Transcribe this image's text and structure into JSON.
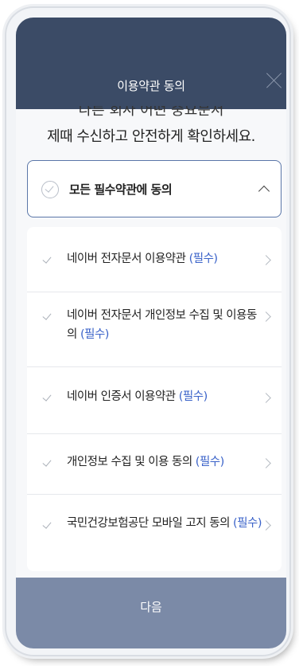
{
  "header": {
    "title": "이용약관 동의"
  },
  "intro": {
    "line1": "다른 회사 어떤 중요문서",
    "line2": "제때 수신하고 안전하게 확인하세요."
  },
  "all_agree": {
    "label": "모든 필수약관에 동의"
  },
  "terms": [
    {
      "label": "네이버 전자문서 이용약관",
      "tag": "(필수)"
    },
    {
      "label": "네이버 전자문서 개인정보 수집 및 이용동의",
      "tag": "(필수)"
    },
    {
      "label": "네이버 인증서 이용약관",
      "tag": "(필수)"
    },
    {
      "label": "개인정보 수집 및 이용 동의",
      "tag": "(필수)"
    },
    {
      "label": "국민건강보험공단 모바일 고지 동의",
      "tag": "(필수)"
    }
  ],
  "footer": {
    "next_label": "다음"
  },
  "colors": {
    "header_bg": "#3b4b66",
    "required_tag": "#3b63c9",
    "next_button_bg": "#7b8aa7"
  }
}
